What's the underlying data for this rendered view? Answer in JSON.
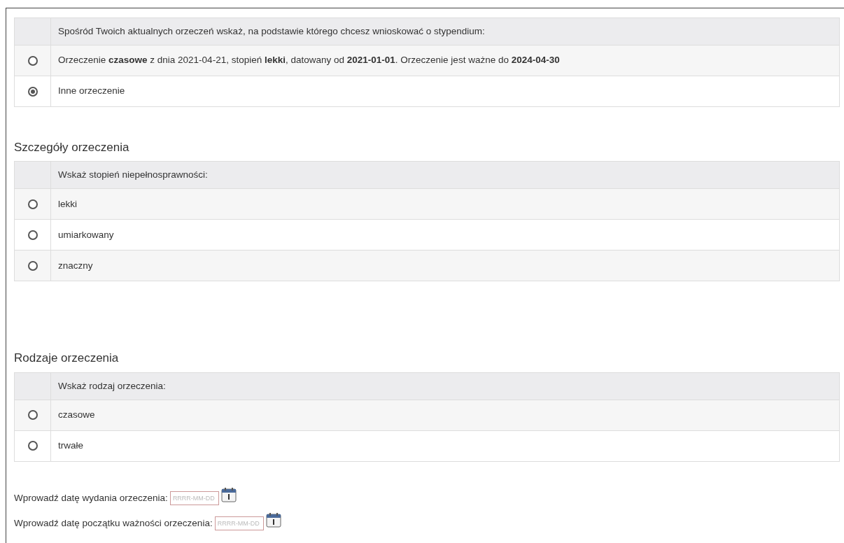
{
  "sections": [
    {
      "table": {
        "header": "Spośród Twoich aktualnych orzeczeń wskaż, na podstawie którego chcesz wnioskować o stypendium:",
        "options": [
          {
            "label": "Orzeczenie **czasowe** z dnia 2021-04-21, stopień **lekki**, datowany od **2021-01-01**. Orzeczenie jest ważne do **2024-04-30**",
            "selected": false
          },
          {
            "label": "Inne orzeczenie",
            "selected": true
          }
        ]
      }
    },
    {
      "heading": "Szczegóły orzeczenia",
      "table": {
        "header": "Wskaż stopień niepełnosprawności:",
        "options": [
          {
            "label": "lekki",
            "selected": false
          },
          {
            "label": "umiarkowany",
            "selected": false
          },
          {
            "label": "znaczny",
            "selected": false
          }
        ]
      }
    },
    {
      "heading": "Rodzaje orzeczenia",
      "table": {
        "header": "Wskaż rodzaj orzeczenia:",
        "options": [
          {
            "label": "czasowe",
            "selected": false
          },
          {
            "label": "trwałe",
            "selected": false
          }
        ]
      }
    }
  ],
  "date_fields": [
    {
      "label": "Wprowadź datę wydania orzeczenia:",
      "placeholder": "RRRR-MM-DD"
    },
    {
      "label": "Wprowadź datę początku ważności orzeczenia:",
      "placeholder": "RRRR-MM-DD"
    }
  ]
}
